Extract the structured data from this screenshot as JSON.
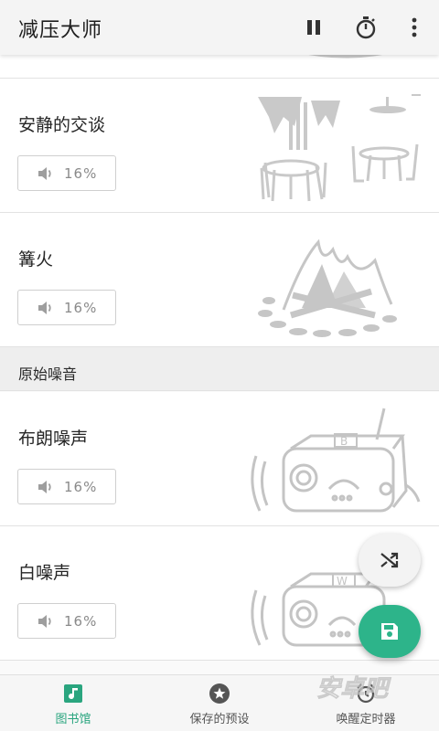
{
  "app": {
    "title": "减压大师"
  },
  "toolbar": {
    "icons": [
      "pause-icon",
      "timer-icon",
      "more-vert-icon"
    ]
  },
  "sounds": [
    {
      "name": "安静的交谈",
      "volume": "16%",
      "art": "cafe-illustration"
    },
    {
      "name": "篝火",
      "volume": "16%",
      "art": "campfire-illustration"
    }
  ],
  "section": {
    "label": "原始噪音"
  },
  "noise_sounds": [
    {
      "name": "布朗噪声",
      "volume": "16%",
      "art": "radio-b-illustration"
    },
    {
      "name": "白噪声",
      "volume": "16%",
      "art": "radio-w-illustration"
    }
  ],
  "fabs": {
    "shuffle_icon": "shuffle-icon",
    "save_icon": "save-icon"
  },
  "bottom_nav": [
    {
      "label": "图书馆",
      "icon": "library-music-icon",
      "active": true
    },
    {
      "label": "保存的预设",
      "icon": "star-icon",
      "active": false
    },
    {
      "label": "唤醒定时器",
      "icon": "alarm-icon",
      "active": false
    }
  ],
  "colors": {
    "accent": "#2db48a",
    "active_tab": "#2aa57f",
    "icon_grey": "#9e9e9e"
  },
  "watermark": {
    "text": "安卓吧"
  }
}
